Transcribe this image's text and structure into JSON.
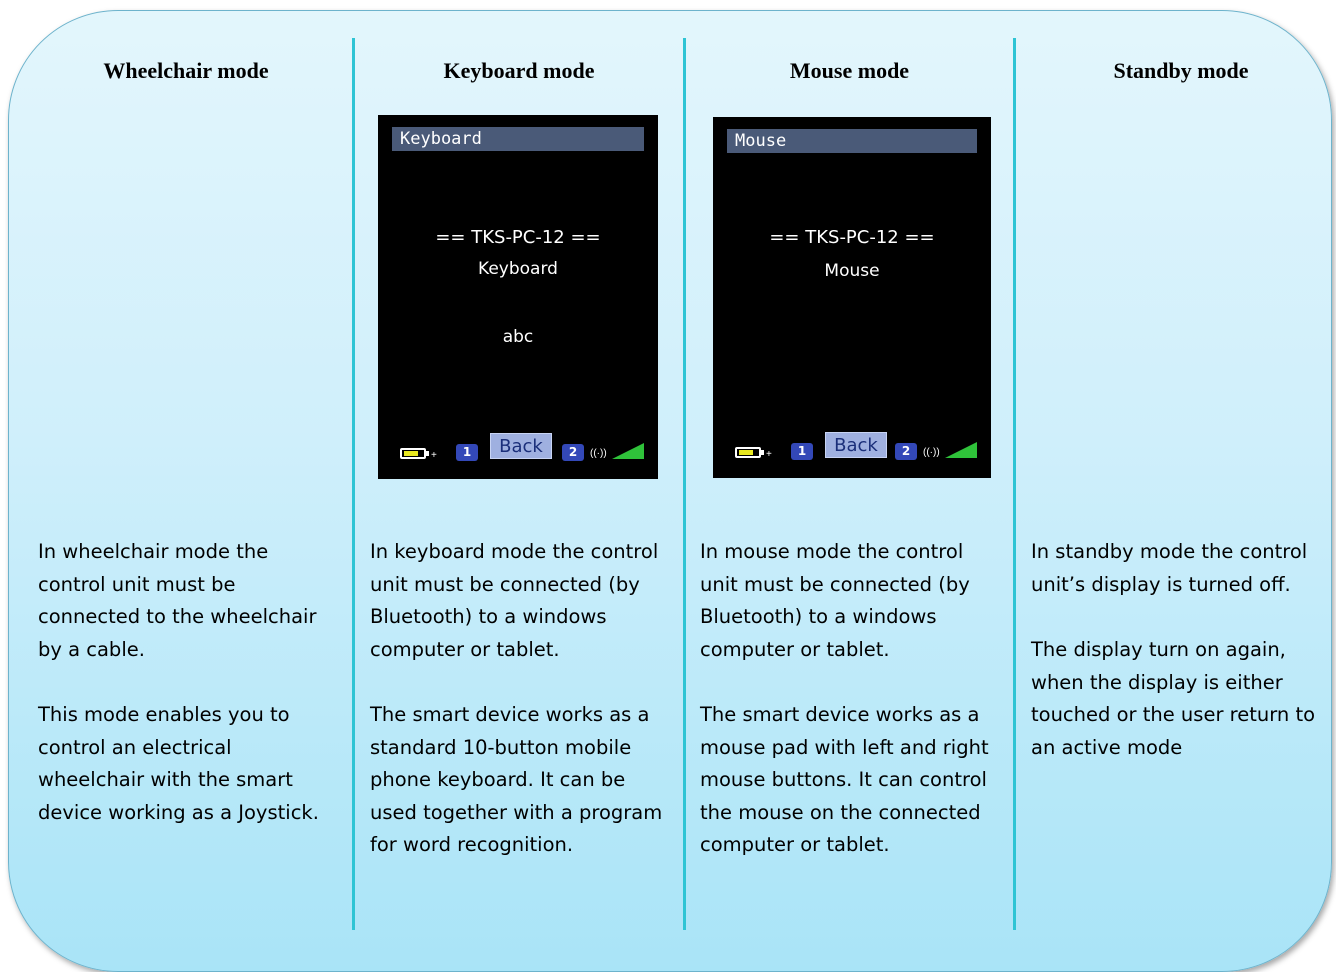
{
  "columns": [
    {
      "title": "Wheelchair mode",
      "paragraphs": [
        "In wheelchair mode the control unit must be connected to the wheelchair by a cable.",
        "This mode enables you to control an electrical wheelchair with the smart device working as a Joystick."
      ]
    },
    {
      "title": "Keyboard mode",
      "screen": {
        "header": "Keyboard",
        "line1": "== TKS-PC-12 ==",
        "line2": "Keyboard",
        "line3": "abc",
        "back": "Back",
        "bt1": "1",
        "bt2": "2"
      },
      "paragraphs": [
        "In keyboard mode the control unit must be connected (by Bluetooth) to a windows computer or tablet.",
        "The smart device works as a standard 10-button mobile phone keyboard. It can be used together with a program for word recognition."
      ]
    },
    {
      "title": "Mouse mode",
      "screen": {
        "header": "Mouse",
        "line1": "== TKS-PC-12 ==",
        "line2": "Mouse",
        "back": "Back",
        "bt1": "1",
        "bt2": "2"
      },
      "paragraphs": [
        "In mouse mode the control unit must be connected (by Bluetooth) to a windows computer or tablet.",
        "The smart device works as a mouse pad with left and right mouse buttons. It can control the mouse on the connected computer or tablet."
      ]
    },
    {
      "title": "Standby mode",
      "paragraphs": [
        "In standby mode the control unit’s display is turned off.",
        "The display turn on again, when the display is either touched or the user return to an active mode"
      ]
    }
  ],
  "colors": {
    "panel_top": "#e3f6fc",
    "panel_bottom": "#a9e4f7",
    "divider": "#2ec4d4",
    "screen_bg": "#000000",
    "screen_header": "#4a5a78",
    "back_button": "#9fb0e0",
    "signal": "#2fc23a",
    "battery": "#e8e820",
    "bluetooth_badge": "#3348b8"
  },
  "icons": [
    "battery-icon",
    "bluetooth-1-icon",
    "bluetooth-2-icon",
    "antenna-icon",
    "signal-strength-icon"
  ]
}
